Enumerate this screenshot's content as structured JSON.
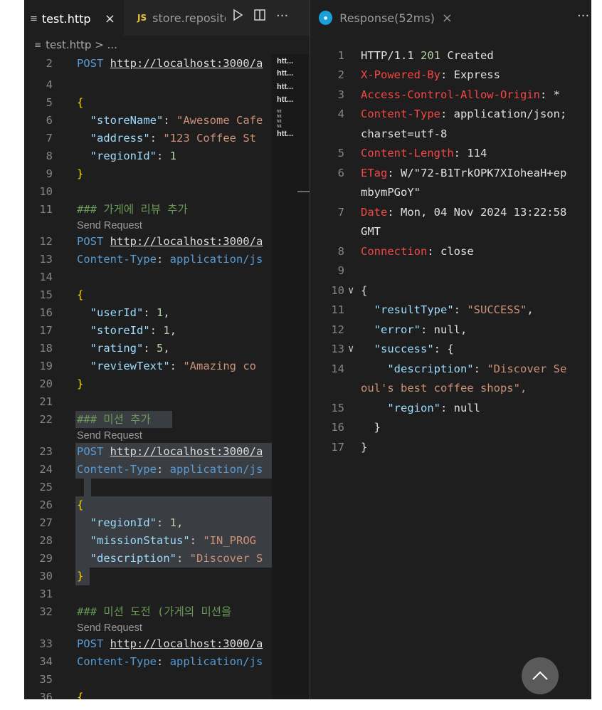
{
  "left_tabs": [
    {
      "label": "test.http",
      "close": "×"
    },
    {
      "label": "store.reposito",
      "badge": "JS"
    }
  ],
  "breadcrumb": "test.http > ...",
  "lens_label": "Send Request",
  "code_lines": [
    {
      "n": "2",
      "t": "POST http://localhost:3000/a"
    },
    {
      "n": "4",
      "t": ""
    },
    {
      "n": "5",
      "t": "{"
    },
    {
      "n": "6",
      "t": "  \"storeName\": \"Awesome Cafe"
    },
    {
      "n": "7",
      "t": "  \"address\": \"123 Coffee St"
    },
    {
      "n": "8",
      "t": "  \"regionId\": 1"
    },
    {
      "n": "9",
      "t": "}"
    },
    {
      "n": "10",
      "t": ""
    },
    {
      "n": "11",
      "t": "### 가게에 리뷰 추가"
    },
    {
      "n": "12",
      "t": "POST http://localhost:3000/a"
    },
    {
      "n": "13",
      "t": "Content-Type: application/js"
    },
    {
      "n": "14",
      "t": ""
    },
    {
      "n": "15",
      "t": "{"
    },
    {
      "n": "16",
      "t": "  \"userId\": 1,"
    },
    {
      "n": "17",
      "t": "  \"storeId\": 1,"
    },
    {
      "n": "18",
      "t": "  \"rating\": 5,"
    },
    {
      "n": "19",
      "t": "  \"reviewText\": \"Amazing co"
    },
    {
      "n": "20",
      "t": "}"
    },
    {
      "n": "21",
      "t": ""
    },
    {
      "n": "22",
      "t": "### 미션 추가"
    },
    {
      "n": "23",
      "t": "POST http://localhost:3000/a"
    },
    {
      "n": "24",
      "t": "Content-Type: application/js"
    },
    {
      "n": "25",
      "t": ""
    },
    {
      "n": "26",
      "t": "{"
    },
    {
      "n": "27",
      "t": "  \"regionId\": 1,"
    },
    {
      "n": "28",
      "t": "  \"missionStatus\": \"IN_PROG"
    },
    {
      "n": "29",
      "t": "  \"description\": \"Discover S"
    },
    {
      "n": "30",
      "t": "}"
    },
    {
      "n": "31",
      "t": ""
    },
    {
      "n": "32",
      "t": "### 미션 도전 (가게의 미션을"
    },
    {
      "n": "33",
      "t": "POST http://localhost:3000/a"
    },
    {
      "n": "34",
      "t": "Content-Type: application/js"
    },
    {
      "n": "35",
      "t": ""
    },
    {
      "n": "36",
      "t": "{"
    }
  ],
  "minimap_labels": [
    "htt...",
    "htt...",
    "htt...",
    "htt...",
    "htt..."
  ],
  "response_tab": "Response(52ms)",
  "response_lines": [
    {
      "n": "1",
      "t": "HTTP/1.1 201 Created"
    },
    {
      "n": "2",
      "t": "X-Powered-By: Express"
    },
    {
      "n": "3",
      "t": "Access-Control-Allow-Origin: *"
    },
    {
      "n": "4",
      "t": "Content-Type: application/json;"
    },
    {
      "n": "",
      "t": "charset=utf-8"
    },
    {
      "n": "5",
      "t": "Content-Length: 114"
    },
    {
      "n": "6",
      "t": "ETag: W/\"72-B1TrkOPK7XIoheaH+ep"
    },
    {
      "n": "",
      "t": "mbymPGoY\""
    },
    {
      "n": "7",
      "t": "Date: Mon, 04 Nov 2024 13:22:58"
    },
    {
      "n": "",
      "t": "GMT"
    },
    {
      "n": "8",
      "t": "Connection: close"
    },
    {
      "n": "9",
      "t": ""
    },
    {
      "n": "10",
      "t": "{"
    },
    {
      "n": "11",
      "t": "  \"resultType\": \"SUCCESS\","
    },
    {
      "n": "12",
      "t": "  \"error\": null,"
    },
    {
      "n": "13",
      "t": "  \"success\": {"
    },
    {
      "n": "14",
      "t": "    \"description\": \"Discover Se"
    },
    {
      "n": "",
      "t": "oul's best coffee shops\","
    },
    {
      "n": "15",
      "t": "    \"region\": null"
    },
    {
      "n": "16",
      "t": "  }"
    },
    {
      "n": "17",
      "t": "}"
    }
  ],
  "colors": {
    "editor_bg": "#1e1e1e",
    "keyword": "#569cd6",
    "string": "#ce9178",
    "property": "#9cdcfe",
    "comment": "#6a9955",
    "header_key": "#f44747"
  },
  "icons": [
    "list-icon",
    "js-file-icon",
    "close-icon",
    "run-icon",
    "split-editor-icon",
    "more-icon",
    "response-icon",
    "chevron-up-icon",
    "fold-chevron-icon"
  ]
}
